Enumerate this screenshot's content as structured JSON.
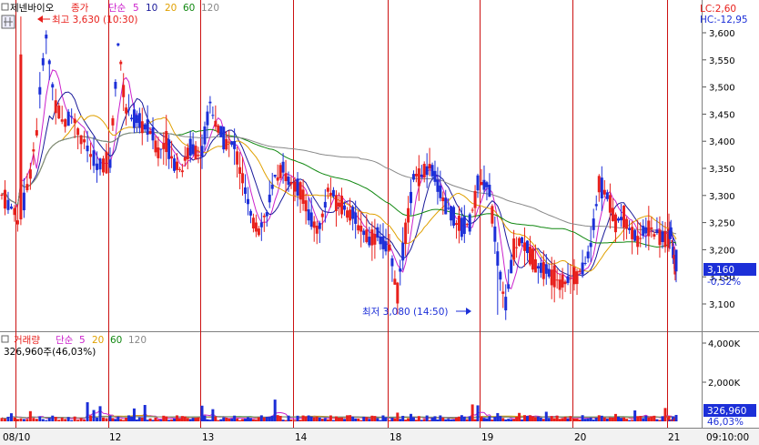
{
  "legend_price": {
    "title": "제넨바이오",
    "close_label": "종가",
    "ma_label": "단순",
    "periods": [
      "5",
      "10",
      "20",
      "60",
      "120"
    ]
  },
  "legend_volume": {
    "title": "거래량",
    "ma_label": "단순",
    "periods": [
      "5",
      "20",
      "60",
      "120"
    ],
    "last_volume_text": "326,960주(46,03%)"
  },
  "annotations": {
    "high": "최고 3,630 (10:30)",
    "low": "최저 3,080 (14:50)",
    "lc": "LC:2,60",
    "hc": "HC:-12,95"
  },
  "price_box": {
    "value": "3,160",
    "change": "-0,32%"
  },
  "volume_box": {
    "value": "326,960",
    "change": "46,03%"
  },
  "bottom_time": "09:10:00",
  "colors": {
    "up": "#e8201c",
    "down": "#1c2fd8",
    "ma5": "#cc22cc",
    "ma10": "#1a1a9a",
    "ma20": "#e0a000",
    "ma60": "#118811",
    "ma120": "#888888",
    "separator": "#cc1111"
  },
  "chart_data": {
    "type": "candlestick",
    "interval": "intraday, multi-day",
    "price_axis": {
      "ticks": [
        "3,600",
        "3,550",
        "3,500",
        "3,450",
        "3,400",
        "3,350",
        "3,300",
        "3,250",
        "3,200",
        "3,150",
        "3,100"
      ],
      "ylim": [
        3070,
        3640
      ]
    },
    "volume_axis": {
      "ticks": [
        "4,000K",
        "2,000K"
      ],
      "ylim": [
        0,
        4400000
      ]
    },
    "date_labels": [
      "08/10",
      "12",
      "13",
      "14",
      "18",
      "19",
      "20",
      "21"
    ],
    "high": {
      "value": 3630,
      "time": "10:30"
    },
    "low": {
      "value": 3080,
      "time": "14:50"
    },
    "last_close": 3160,
    "change_pct": -0.32,
    "last_volume": 326960,
    "day_segments": [
      {
        "date": "08/10",
        "open": 3300,
        "path": [
          3300,
          3280,
          3250,
          3320,
          3420,
          3600,
          3480,
          3430,
          3450,
          3410,
          3380,
          3350,
          3360
        ]
      },
      {
        "date": "12",
        "open": 3360,
        "path": [
          3360,
          3580,
          3460,
          3440,
          3430,
          3420,
          3380,
          3400,
          3360,
          3350,
          3390,
          3380
        ]
      },
      {
        "date": "13",
        "open": 3380,
        "path": [
          3380,
          3470,
          3420,
          3400,
          3390,
          3330,
          3260,
          3240,
          3270,
          3330,
          3350,
          3320
        ]
      },
      {
        "date": "14",
        "open": 3320,
        "path": [
          3320,
          3300,
          3250,
          3240,
          3310,
          3290,
          3280,
          3260,
          3240,
          3220,
          3230,
          3200
        ]
      },
      {
        "date": "18",
        "open": 3200,
        "path": [
          3200,
          3120,
          3230,
          3330,
          3340,
          3350,
          3320,
          3280,
          3260,
          3240,
          3250,
          3320
        ]
      },
      {
        "date": "19",
        "open": 3320,
        "path": [
          3320,
          3310,
          3180,
          3100,
          3200,
          3220,
          3190,
          3170,
          3160,
          3150,
          3140,
          3150
        ]
      },
      {
        "date": "20",
        "open": 3150,
        "path": [
          3150,
          3160,
          3210,
          3320,
          3300,
          3250,
          3260,
          3230,
          3220,
          3240,
          3230,
          3220
        ]
      },
      {
        "date": "21",
        "open": 3220,
        "path": [
          3220,
          3240,
          3200,
          3180,
          3160
        ]
      }
    ]
  }
}
